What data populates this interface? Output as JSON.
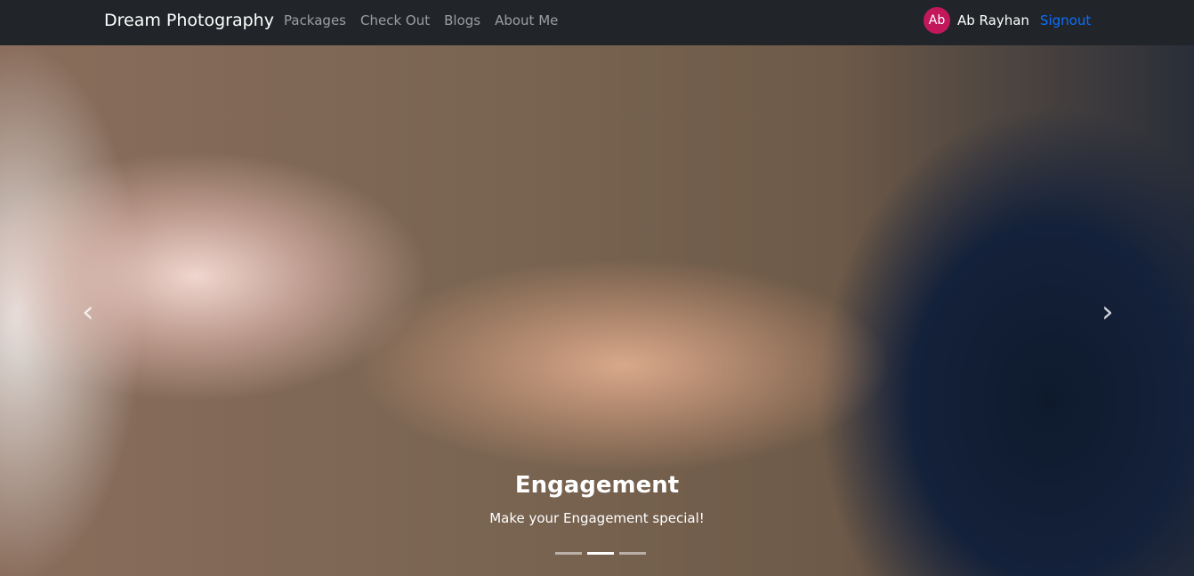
{
  "nav": {
    "brand": "Dream Photography",
    "links": [
      "Packages",
      "Check Out",
      "Blogs",
      "About Me"
    ],
    "user": {
      "avatar_initials": "Ab",
      "name": "Ab Rayhan",
      "signout": "Signout"
    },
    "accent": "#0d6efd"
  },
  "carousel": {
    "caption_title": "Engagement",
    "caption_text": "Make your Engagement special!",
    "slide_count": 3,
    "active_slide": 2,
    "prev_icon": "chevron-left-icon",
    "next_icon": "chevron-right-icon"
  }
}
